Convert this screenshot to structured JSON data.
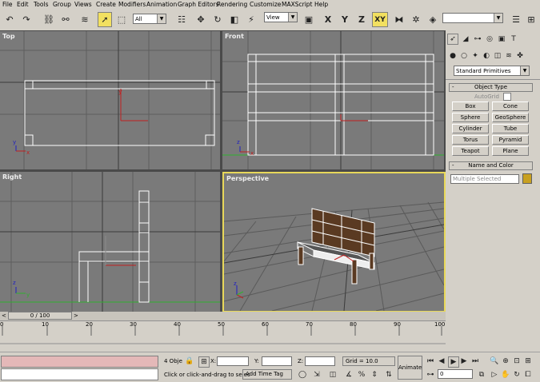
{
  "menu": [
    "File",
    "Edit",
    "Tools",
    "Group",
    "Views",
    "Create",
    "Modifiers",
    "Animation",
    "Graph Editors",
    "Rendering",
    "Customize",
    "MAXScript",
    "Help"
  ],
  "toolbar": {
    "selection_filter": "All",
    "ref_coord": "View",
    "axis_x": "X",
    "axis_y": "Y",
    "axis_z": "Z",
    "axis_xy": "XY",
    "named_selection": ""
  },
  "viewports": {
    "top": "Top",
    "front": "Front",
    "right": "Right",
    "perspective": "Perspective",
    "axis_x": "x",
    "axis_y": "y",
    "axis_z": "z"
  },
  "panel": {
    "category": "Standard Primitives",
    "object_type_title": "Object Type",
    "autogrid_label": "AutoGrid",
    "buttons": [
      "Box",
      "Cone",
      "Sphere",
      "GeoSphere",
      "Cylinder",
      "Tube",
      "Torus",
      "Pyramid",
      "Teapot",
      "Plane"
    ],
    "name_color_title": "Name and Color",
    "name_value": "Multiple Selected",
    "object_color": "#c8a020"
  },
  "timeline": {
    "frame": "0 / 100",
    "ticks": [
      "0",
      "10",
      "20",
      "30",
      "40",
      "50",
      "60",
      "70",
      "80",
      "90",
      "100"
    ]
  },
  "status": {
    "selected": "4 Obje",
    "x_label": "X:",
    "y_label": "Y:",
    "z_label": "Z:",
    "x_value": "",
    "y_value": "",
    "z_value": "",
    "grid": "Grid = 10.0",
    "prompt": "Click or click-and-drag to selec",
    "add_time_tag": "Add Time Tag",
    "animate": "Animate",
    "current_frame": "0"
  },
  "colors": {
    "viewport_bg": "#7a7a7a",
    "active_border": "#e8d85a",
    "selection": "#ffffff",
    "axis_red": "#c02020",
    "axis_green": "#20a020",
    "axis_blue": "#2020c0"
  }
}
